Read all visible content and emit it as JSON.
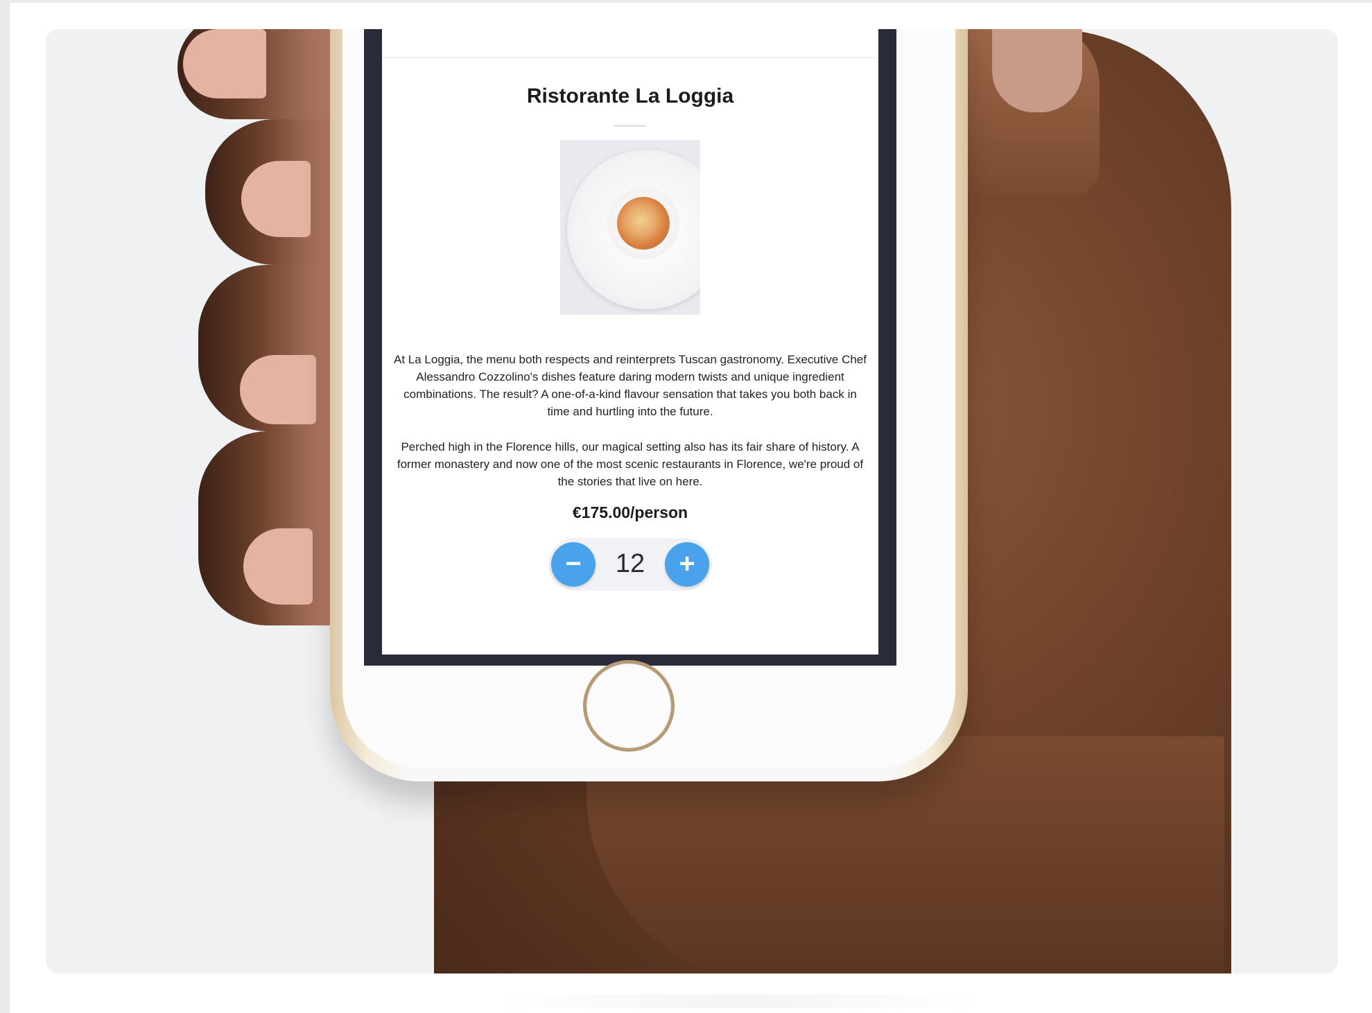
{
  "restaurant": {
    "name": "Ristorante La Loggia",
    "description_1": "At La Loggia, the menu both respects and reinterprets Tuscan gastronomy. Executive Chef Alessandro Cozzolino's dishes feature daring modern twists and unique ingredient combinations. The result? A one-of-a-kind flavour sensation that takes you both back in time and hurtling into the future.",
    "description_2": "Perched high in the Florence hills, our magical setting also has its fair share of history. A former monastery and now one of the most scenic restaurants in Florence, we're proud of the stories that live on here.",
    "price": "€175.00/person",
    "dish_image_alt": "dish-photo"
  },
  "stepper": {
    "minus_label": "−",
    "value": "12",
    "plus_label": "+"
  },
  "colors": {
    "accent": "#4aa3ea",
    "background": "#f0f1f3",
    "bezel": "#2a2b3a",
    "gold_trim": "#b59a72"
  },
  "icons": {
    "minus": "minus-icon",
    "plus": "plus-icon",
    "home": "home-button-icon"
  }
}
